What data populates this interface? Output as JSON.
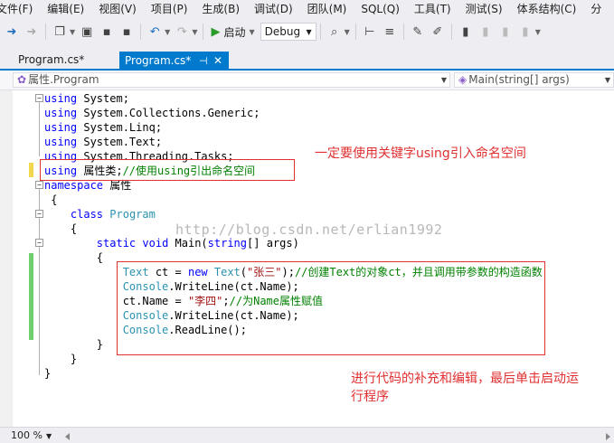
{
  "menu": {
    "items": [
      "文件(F)",
      "编辑(E)",
      "视图(V)",
      "项目(P)",
      "生成(B)",
      "调试(D)",
      "团队(M)",
      "SQL(Q)",
      "工具(T)",
      "测试(S)",
      "体系结构(C)",
      "分"
    ]
  },
  "toolbar": {
    "start_label": "启动",
    "config_value": "Debug",
    "icons": [
      "back-icon",
      "forward-icon",
      "new-project-icon",
      "open-icon",
      "save-icon",
      "save-all-icon",
      "undo-icon",
      "redo-icon",
      "start-icon",
      "find-icon",
      "comment-icon",
      "bookmark-icon"
    ]
  },
  "tabs": [
    {
      "label": "Program.cs*",
      "active": false
    },
    {
      "label": "Program.cs*",
      "active": true,
      "pin": "⊣",
      "close": "✕"
    }
  ],
  "navbar": {
    "left": "属性.Program",
    "right": "Main(string[] args)"
  },
  "code": {
    "lines": [
      [
        {
          "t": "using",
          "c": "kw"
        },
        {
          "t": " System;",
          "c": ""
        }
      ],
      [
        {
          "t": "using",
          "c": "kw"
        },
        {
          "t": " System.Collections.Generic;",
          "c": ""
        }
      ],
      [
        {
          "t": "using",
          "c": "kw"
        },
        {
          "t": " System.Linq;",
          "c": ""
        }
      ],
      [
        {
          "t": "using",
          "c": "kw"
        },
        {
          "t": " System.Text;",
          "c": ""
        }
      ],
      [
        {
          "t": "using",
          "c": "kw"
        },
        {
          "t": " System.Threading.Tasks;",
          "c": ""
        }
      ],
      [
        {
          "t": "using",
          "c": "kw"
        },
        {
          "t": " 属性类;",
          "c": ""
        },
        {
          "t": "//使用using引出命名空间",
          "c": "cm"
        }
      ],
      [
        {
          "t": "namespace",
          "c": "kw"
        },
        {
          "t": " 属性",
          "c": ""
        }
      ],
      [
        {
          "t": " {",
          "c": ""
        }
      ],
      [
        {
          "t": "    ",
          "c": ""
        },
        {
          "t": "class",
          "c": "kw"
        },
        {
          "t": " ",
          "c": ""
        },
        {
          "t": "Program",
          "c": "type"
        }
      ],
      [
        {
          "t": "    {",
          "c": ""
        }
      ],
      [
        {
          "t": "        ",
          "c": ""
        },
        {
          "t": "static",
          "c": "kw"
        },
        {
          "t": " ",
          "c": ""
        },
        {
          "t": "void",
          "c": "kw"
        },
        {
          "t": " Main(",
          "c": ""
        },
        {
          "t": "string",
          "c": "kw"
        },
        {
          "t": "[] args)",
          "c": ""
        }
      ],
      [
        {
          "t": "        {",
          "c": ""
        }
      ],
      [
        {
          "t": "            ",
          "c": ""
        },
        {
          "t": "Text",
          "c": "type"
        },
        {
          "t": " ct = ",
          "c": ""
        },
        {
          "t": "new",
          "c": "kw"
        },
        {
          "t": " ",
          "c": ""
        },
        {
          "t": "Text",
          "c": "type"
        },
        {
          "t": "(",
          "c": ""
        },
        {
          "t": "\"张三\"",
          "c": "str"
        },
        {
          "t": ");",
          "c": ""
        },
        {
          "t": "//创建Text的对象ct，并且调用带参数的构造函数",
          "c": "cm"
        }
      ],
      [
        {
          "t": "            ",
          "c": ""
        },
        {
          "t": "Console",
          "c": "type"
        },
        {
          "t": ".WriteLine(ct.Name);",
          "c": ""
        }
      ],
      [
        {
          "t": "            ct.Name = ",
          "c": ""
        },
        {
          "t": "\"李四\"",
          "c": "str"
        },
        {
          "t": ";",
          "c": ""
        },
        {
          "t": "//为Name属性赋值",
          "c": "cm"
        }
      ],
      [
        {
          "t": "            ",
          "c": ""
        },
        {
          "t": "Console",
          "c": "type"
        },
        {
          "t": ".WriteLine(ct.Name);",
          "c": ""
        }
      ],
      [
        {
          "t": "            ",
          "c": ""
        },
        {
          "t": "Console",
          "c": "type"
        },
        {
          "t": ".ReadLine();",
          "c": ""
        }
      ],
      [
        {
          "t": "        }",
          "c": ""
        }
      ],
      [
        {
          "t": "    }",
          "c": ""
        }
      ],
      [
        {
          "t": "}",
          "c": ""
        }
      ]
    ]
  },
  "annotations": {
    "using_note": "一定要使用关键字using引入命名空间",
    "edit_note_line1": "进行代码的补充和编辑，最后单击启动运",
    "edit_note_line2": "行程序"
  },
  "watermark": "http://blog.csdn.net/erlian1992",
  "status": {
    "zoom": "100 %"
  },
  "colors": {
    "accent": "#007acc",
    "annotation_red": "#e03030",
    "keyword": "#0000ff",
    "type": "#2b91af",
    "comment": "#008000",
    "string": "#a31515"
  }
}
